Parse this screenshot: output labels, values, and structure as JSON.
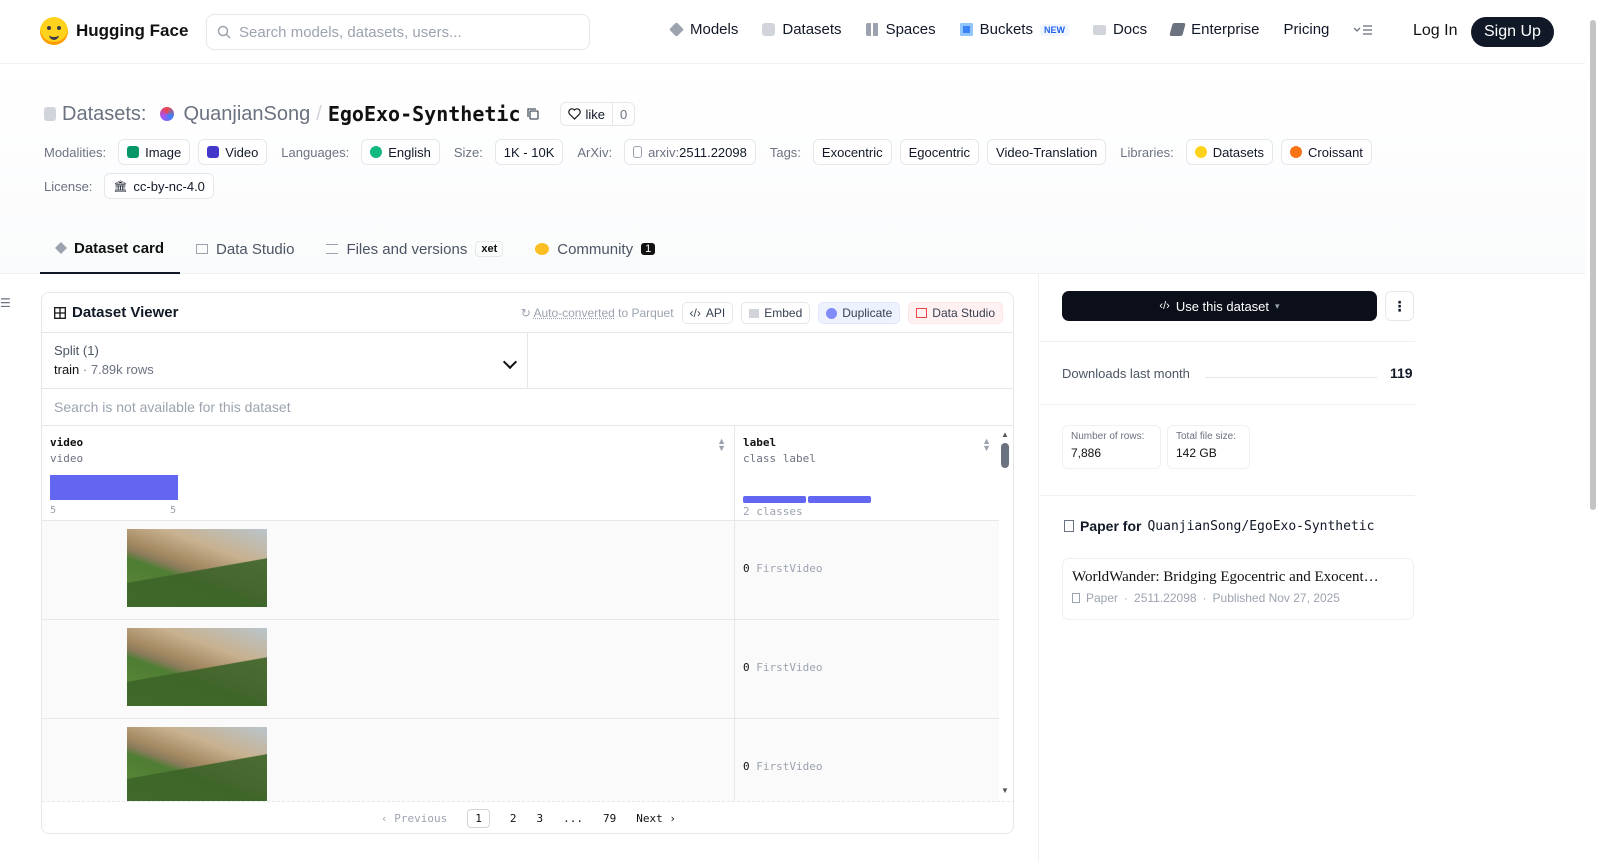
{
  "nav": {
    "brand": "Hugging Face",
    "search_placeholder": "Search models, datasets, users...",
    "links": [
      {
        "label": "Models",
        "icon": "cube-icon",
        "color": "#9ca3af"
      },
      {
        "label": "Datasets",
        "icon": "database-icon",
        "color": "#9ca3af"
      },
      {
        "label": "Spaces",
        "icon": "grid-icon",
        "color": "#9ca3af"
      },
      {
        "label": "Buckets",
        "icon": "bucket-icon",
        "color": "#3b82f6"
      },
      {
        "label": "Docs",
        "icon": "book-icon",
        "color": "#9ca3af"
      },
      {
        "label": "Enterprise",
        "icon": "enterprise-icon",
        "color": "#6b7280"
      },
      {
        "label": "Pricing"
      }
    ],
    "new_badge": "NEW",
    "login": "Log In",
    "signup": "Sign Up"
  },
  "header": {
    "section": "Datasets:",
    "owner": "QuanjianSong",
    "separator": "/",
    "name": "EgoExo-Synthetic",
    "like_label": "like",
    "like_count": "0",
    "modalities_label": "Modalities:",
    "modalities": [
      "Image",
      "Video"
    ],
    "languages_label": "Languages:",
    "language": "English",
    "size_label": "Size:",
    "size": "1K - 10K",
    "arxiv_label": "ArXiv:",
    "arxiv_prefix": "arxiv:",
    "arxiv_id": "2511.22098",
    "tags_label": "Tags:",
    "tags": [
      "Exocentric",
      "Egocentric",
      "Video-Translation"
    ],
    "libraries_label": "Libraries:",
    "libraries": [
      "Datasets",
      "Croissant"
    ],
    "license_label": "License:",
    "license": "cc-by-nc-4.0"
  },
  "tabs": [
    {
      "label": "Dataset card"
    },
    {
      "label": "Data Studio"
    },
    {
      "label": "Files and versions"
    },
    {
      "label": "Community"
    }
  ],
  "xet_label": "xet",
  "community_count": "1",
  "viewer": {
    "title": "Dataset Viewer",
    "auto_converted": "Auto-converted",
    "to_parquet": " to Parquet",
    "api": "API",
    "embed": "Embed",
    "duplicate": "Duplicate",
    "data_studio": "Data Studio",
    "split_label": "Split (1)",
    "split_name": "train",
    "split_sep": " · ",
    "split_rows": "7.89k rows",
    "search_unavailable": "Search is not available for this dataset",
    "columns": [
      {
        "name": "video",
        "type": "video",
        "hist_min": "5",
        "hist_max": "5"
      },
      {
        "name": "label",
        "type": "class label",
        "classes": "2 classes"
      }
    ],
    "rows": [
      {
        "label_id": "0",
        "label_name": "FirstVideo"
      },
      {
        "label_id": "0",
        "label_name": "FirstVideo"
      },
      {
        "label_id": "0",
        "label_name": "FirstVideo"
      }
    ],
    "pager": {
      "previous": "‹ Previous",
      "pages": [
        "1",
        "2",
        "3",
        "...",
        "79"
      ],
      "next": "Next ›"
    }
  },
  "sidebar": {
    "use_dataset": "Use this dataset",
    "downloads_label": "Downloads last month",
    "downloads_value": "119",
    "rows_label": "Number of rows:",
    "rows_value": "7,886",
    "size_label": "Total file size:",
    "size_value": "142 GB",
    "paper_for": "Paper for",
    "paper_repo": "QuanjianSong/EgoExo-Synthetic",
    "paper_title": "WorldWander: Bridging Egocentric and Exocentric Worlds",
    "paper_kind": "Paper",
    "paper_id": "2511.22098",
    "paper_published": "Published Nov 27, 2025"
  }
}
